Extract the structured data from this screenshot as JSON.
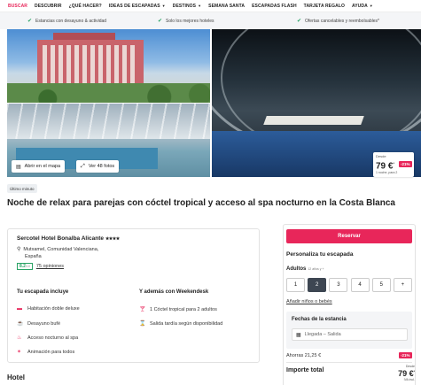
{
  "nav": {
    "items": [
      {
        "label": "BUSCAR",
        "active": true,
        "caret": false
      },
      {
        "label": "DESCUBRIR",
        "active": false,
        "caret": false
      },
      {
        "label": "¿QUÉ HACER?",
        "active": false,
        "caret": false
      },
      {
        "label": "IDEAS DE ESCAPADAS",
        "active": false,
        "caret": true
      },
      {
        "label": "DESTINOS",
        "active": false,
        "caret": true
      },
      {
        "label": "SEMANA SANTA",
        "active": false,
        "caret": false
      },
      {
        "label": "ESCAPADAS FLASH",
        "active": false,
        "caret": false
      },
      {
        "label": "TARJETA REGALO",
        "active": false,
        "caret": false
      },
      {
        "label": "AYUDA",
        "active": false,
        "caret": true
      }
    ]
  },
  "perks": [
    "Estancias con desayuno & actividad",
    "Solo los mejores hoteles",
    "Ofertas cancelables y reembolsables*"
  ],
  "gallery": {
    "map_button": "Abrir en el mapa",
    "photos_button": "Ver 48 fotos",
    "price": {
      "from": "Desde",
      "amount": "79 €",
      "asterisk": "*",
      "per": "1 noche, para 2",
      "discount": "-21%"
    }
  },
  "tag": "Último minuto",
  "title": "Noche de relax para parejas con cóctel tropical y acceso al spa nocturno en la Costa Blanca",
  "hotel": {
    "name": "Sercotel Hotel Bonalba Alicante",
    "stars": "★★★★",
    "address_line1": "Mutxamel, Comunidad Valenciana,",
    "address_line2": "España",
    "score": "8.2",
    "score_max": "/10",
    "opinions": "75 opiniones"
  },
  "includes": {
    "heading": "Tu escapada incluye",
    "items": [
      "Habitación doble deluxe",
      "Desayuno bufé",
      "Acceso nocturno al spa",
      "Animación para todos"
    ]
  },
  "extras": {
    "heading": "Y además con Weekendesk",
    "items": [
      "1 Cóctel tropical para 2 adultos",
      "Salida tardía según disponibilidad"
    ]
  },
  "section_hotel": "Hotel",
  "booking": {
    "reserve": "Reservar",
    "customize": "Personaliza tu escapada",
    "adults": "Adultos",
    "adults_note": "12 años y +",
    "counts": [
      "1",
      "2",
      "3",
      "4",
      "5",
      "+"
    ],
    "selected_count": "2",
    "add_kids": "Añadir niños o bebés",
    "dates_label": "Fechas de la estancia",
    "dates_placeholder": "Llegada – Salida",
    "savings": "Ahorras 21,25 €",
    "savings_discount": "-21%",
    "total_label": "Importe total",
    "total_from": "Desde",
    "total_amount": "79 €",
    "total_asterisk": "*",
    "total_iva": "IVA incl."
  },
  "colors": {
    "accent": "#e8265a",
    "check": "#2aa365",
    "selected": "#3d4652"
  }
}
